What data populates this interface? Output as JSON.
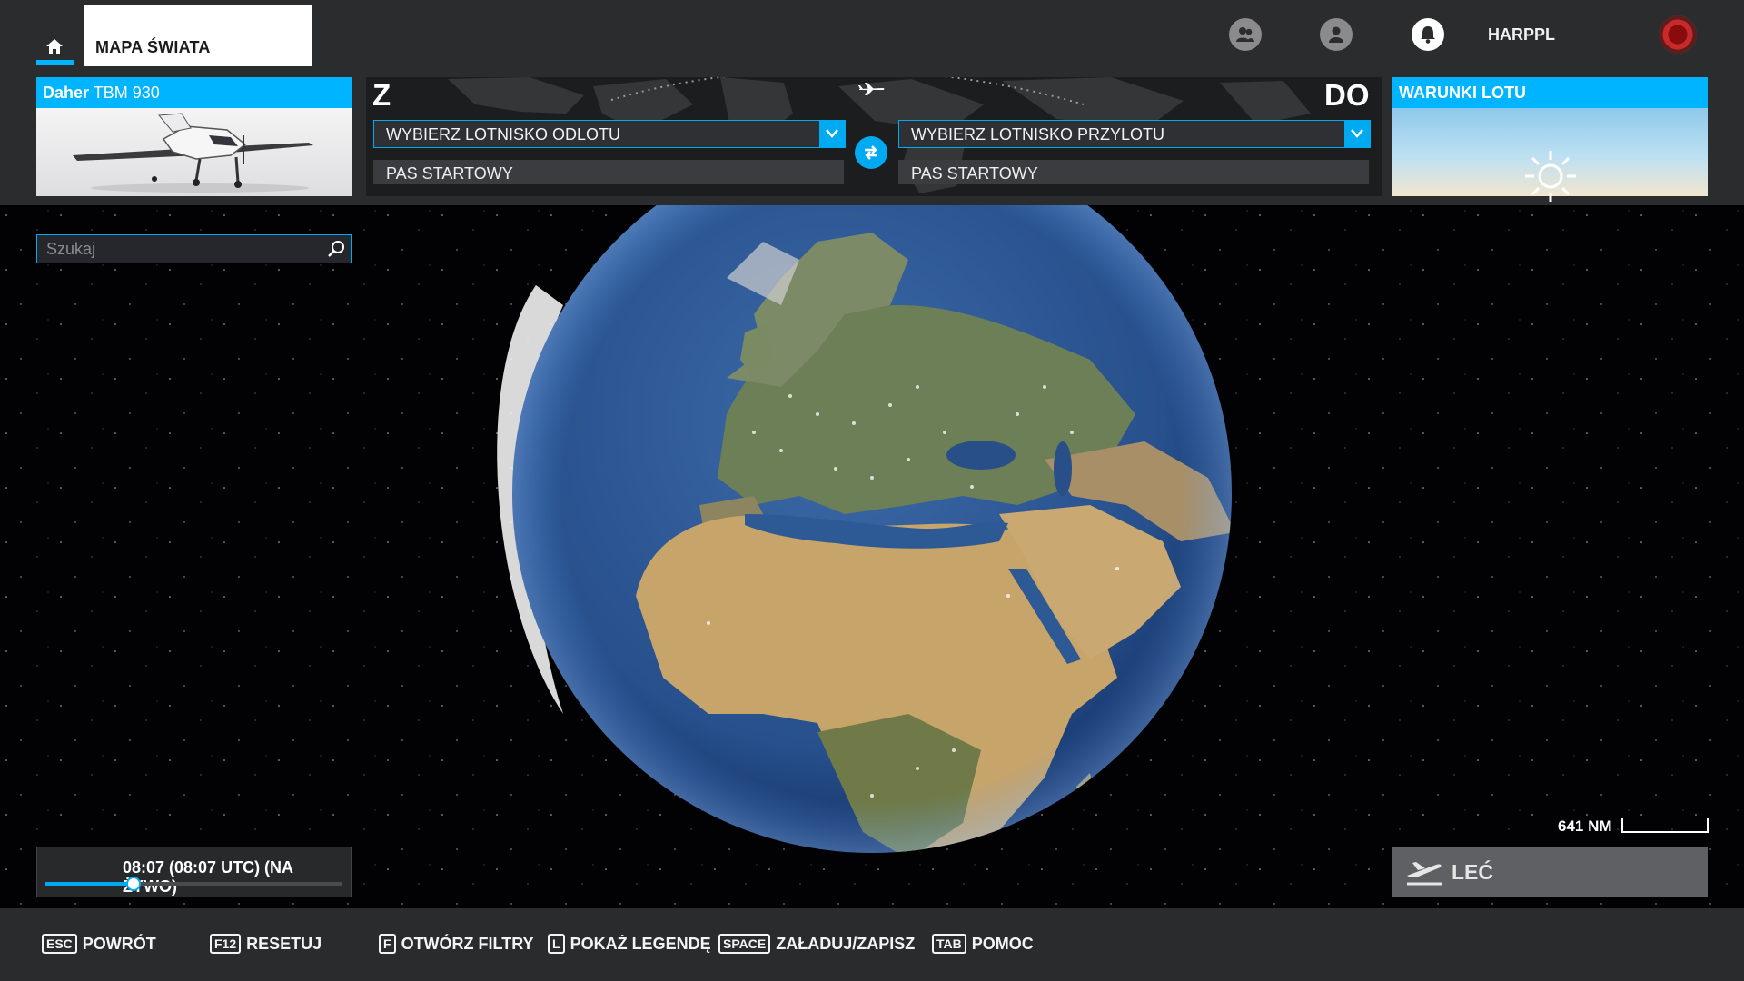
{
  "top_nav": {
    "tab_label": "MAPA ŚWIATA",
    "username": "HARPPL"
  },
  "aircraft": {
    "brand": "Daher",
    "model": " TBM 930"
  },
  "route": {
    "from_label": "Z",
    "to_label": "DO",
    "departure_placeholder": "WYBIERZ LOTNISKO ODLOTU",
    "arrival_placeholder": "WYBIERZ LOTNISKO PRZYLOTU",
    "departure_runway": "PAS STARTOWY",
    "arrival_runway": "PAS STARTOWY"
  },
  "weather": {
    "title": "WARUNKI LOTU"
  },
  "search": {
    "placeholder": "Szukaj"
  },
  "map": {
    "scale_label": "641 NM"
  },
  "time": {
    "text": "08:07 (08:07 UTC) (NA ŻYWO)",
    "progress": 0.3
  },
  "fly": {
    "label": "LEĆ"
  },
  "footer": {
    "hints": [
      {
        "key": "ESC",
        "label": "POWRÓT"
      },
      {
        "key": "F12",
        "label": "RESETUJ"
      },
      {
        "key": "F",
        "label": "OTWÓRZ FILTRY"
      },
      {
        "key": "L",
        "label": "POKAŻ LEGENDĘ"
      },
      {
        "key": "SPACE",
        "label": "ZAŁADUJ/ZAPISZ"
      },
      {
        "key": "TAB",
        "label": "POMOC"
      }
    ]
  },
  "colors": {
    "accent": "#00aaf0",
    "bar_background": "#2b2c2e",
    "space_background": "#020204",
    "fly_button": "#5f6063"
  }
}
